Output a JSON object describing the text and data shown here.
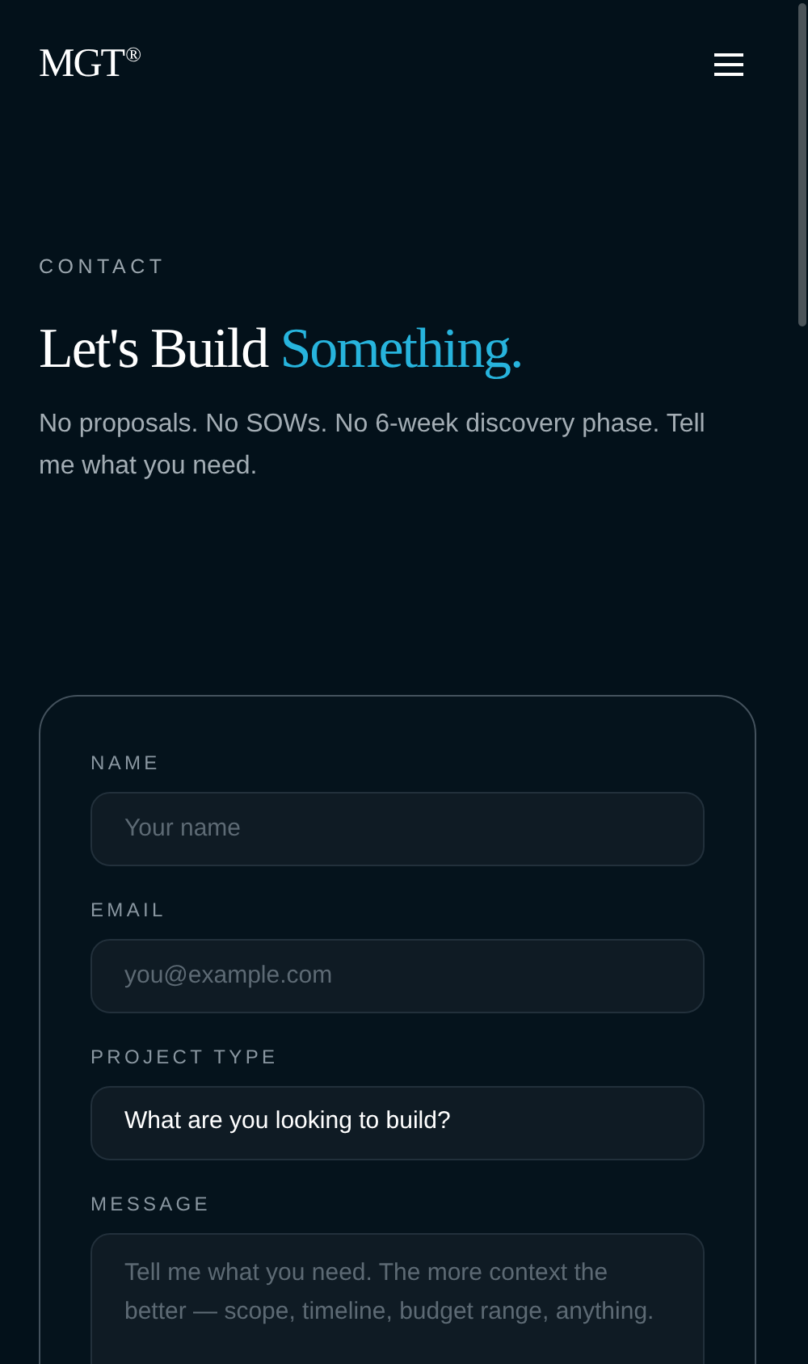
{
  "header": {
    "logo": "MGT",
    "logo_mark": "®"
  },
  "section": {
    "eyebrow": "CONTACT",
    "title": "Let's Build",
    "title_highlight": "Something.",
    "intro": "No proposals. No SOWs. No 6-week discovery phase. Tell me what you need."
  },
  "form": {
    "fields": [
      {
        "kind": "input",
        "label": "NAME",
        "placeholder": "Your name"
      },
      {
        "kind": "input",
        "label": "EMAIL",
        "placeholder": "you@example.com"
      },
      {
        "kind": "select",
        "label": "PROJECT TYPE",
        "value": "What are you looking to build?"
      },
      {
        "kind": "textarea",
        "label": "MESSAGE",
        "placeholder": "Tell me what you need. The more context the better — scope, timeline, budget range, anything."
      }
    ]
  }
}
